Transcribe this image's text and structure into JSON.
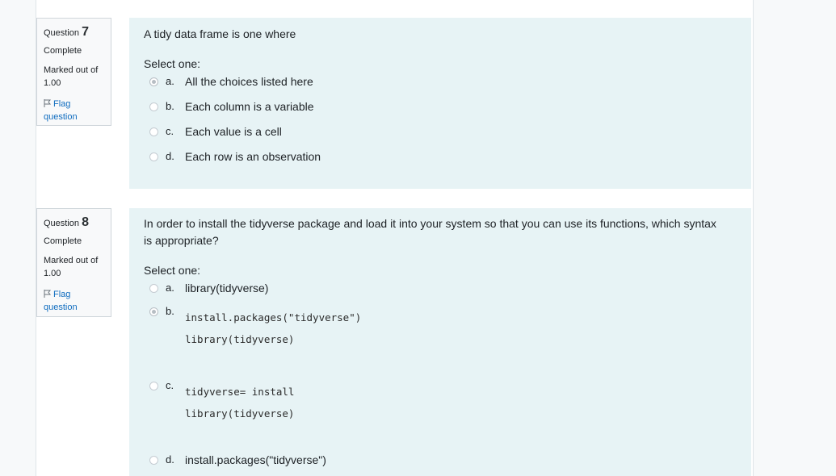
{
  "questions": [
    {
      "label": "Question",
      "number": "7",
      "state": "Complete",
      "grade": "Marked out of 1.00",
      "flag": "Flag question",
      "text": "A tidy data frame is one where",
      "prompt": "Select one:",
      "options": [
        {
          "letter": "a.",
          "text": "All the choices listed here",
          "selected": true
        },
        {
          "letter": "b.",
          "text": "Each column is a variable",
          "selected": false
        },
        {
          "letter": "c.",
          "text": "Each value is a cell",
          "selected": false
        },
        {
          "letter": "d.",
          "text": "Each row is an observation",
          "selected": false
        }
      ]
    },
    {
      "label": "Question",
      "number": "8",
      "state": "Complete",
      "grade": "Marked out of 1.00",
      "flag": "Flag question",
      "text": "In order to install the tidyverse package and load it into your system so that you can use its functions, which syntax is appropriate?",
      "prompt": "Select one:",
      "options": [
        {
          "letter": "a.",
          "text": "library(tidyverse)",
          "selected": false
        },
        {
          "letter": "b.",
          "line1": "install.packages(\"tidyverse\")",
          "line2": "library(tidyverse)",
          "selected": true
        },
        {
          "letter": "c.",
          "line1": "tidyverse= install",
          "line2": "library(tidyverse)",
          "selected": false
        },
        {
          "letter": "d.",
          "text": "install.packages(\"tidyverse\")",
          "selected": false
        }
      ]
    }
  ]
}
